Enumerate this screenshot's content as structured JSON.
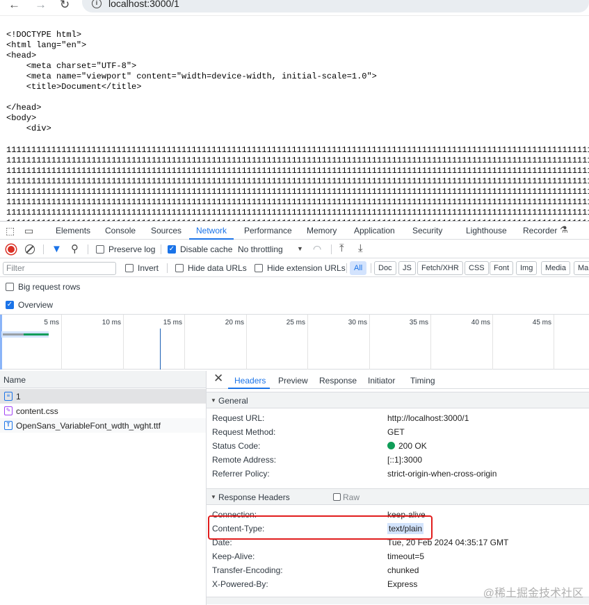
{
  "browser": {
    "url": "localhost:3000/1"
  },
  "page": {
    "source_lines": "<!DOCTYPE html>\n<html lang=\"en\">\n<head>\n    <meta charset=\"UTF-8\">\n    <meta name=\"viewport\" content=\"width=device-width, initial-scale=1.0\">\n    <title>Document</title>\n\n</head>\n<body>\n    <div>",
    "ones_lines": "11111111111111111111111111111111111111111111111111111111111111111111111111111111111111111111111111111111111111111111111111111111111111111111\n11111111111111111111111111111111111111111111111111111111111111111111111111111111111111111111111111111111111111111111111111111111111111111111\n11111111111111111111111111111111111111111111111111111111111111111111111111111111111111111111111111111111111111111111111111111111111111111111\n11111111111111111111111111111111111111111111111111111111111111111111111111111111111111111111111111111111111111111111111111111111111111111111\n11111111111111111111111111111111111111111111111111111111111111111111111111111111111111111111111111111111111111111111111111111111111111111111\n11111111111111111111111111111111111111111111111111111111111111111111111111111111111111111111111111111111111111111111111111111111111111111111\n11111111111111111111111111111111111111111111111111111111111111111111111111111111111111111111111111111111111111111111111111111111111111111111\n11111111111111111111111111111111111111111111111111111111111111111111111111111111111111111111111111111111111111111111111111111111111111111111"
  },
  "devtools": {
    "tabs": [
      "Elements",
      "Console",
      "Sources",
      "Network",
      "Performance",
      "Memory",
      "Application",
      "Security",
      "Lighthouse",
      "Recorder"
    ],
    "active_tab": "Network",
    "toolbar": {
      "preserve_log": "Preserve log",
      "disable_cache": "Disable cache",
      "throttling": "No throttling"
    },
    "filter": {
      "placeholder": "Filter",
      "invert": "Invert",
      "hide_data_urls": "Hide data URLs",
      "hide_extension_urls": "Hide extension URLs",
      "types": [
        "All",
        "Doc",
        "JS",
        "Fetch/XHR",
        "CSS",
        "Font",
        "Img",
        "Media",
        "Ma"
      ]
    },
    "options": {
      "big_request_rows": "Big request rows",
      "overview": "Overview"
    },
    "overview_ticks": [
      "5 ms",
      "10 ms",
      "15 ms",
      "20 ms",
      "25 ms",
      "30 ms",
      "35 ms",
      "40 ms",
      "45 ms"
    ],
    "requests": {
      "column_name": "Name",
      "items": [
        {
          "name": "1",
          "icon": "document-icon"
        },
        {
          "name": "content.css",
          "icon": "stylesheet-icon"
        },
        {
          "name": "OpenSans_VariableFont_wdth_wght.ttf",
          "icon": "font-icon"
        }
      ]
    },
    "detail": {
      "tabs": [
        "Headers",
        "Preview",
        "Response",
        "Initiator",
        "Timing"
      ],
      "active_tab": "Headers",
      "general": {
        "title": "General",
        "rows": [
          {
            "key": "Request URL:",
            "value": "http://localhost:3000/1"
          },
          {
            "key": "Request Method:",
            "value": "GET"
          },
          {
            "key": "Status Code:",
            "value": "200 OK"
          },
          {
            "key": "Remote Address:",
            "value": "[::1]:3000"
          },
          {
            "key": "Referrer Policy:",
            "value": "strict-origin-when-cross-origin"
          }
        ]
      },
      "response_headers": {
        "title": "Response Headers",
        "raw_label": "Raw",
        "rows": [
          {
            "key": "Connection:",
            "value": "keep-alive"
          },
          {
            "key": "Content-Type:",
            "value": "text/plain"
          },
          {
            "key": "Date:",
            "value": "Tue, 20 Feb 2024 04:35:17 GMT"
          },
          {
            "key": "Keep-Alive:",
            "value": "timeout=5"
          },
          {
            "key": "Transfer-Encoding:",
            "value": "chunked"
          },
          {
            "key": "X-Powered-By:",
            "value": "Express"
          }
        ]
      }
    }
  },
  "watermark": "@稀土掘金技术社区",
  "colors": {
    "accent": "#1a73e8",
    "record": "#d93025",
    "status_ok": "#0f9d58",
    "annotation_box": "#e11d1d"
  }
}
